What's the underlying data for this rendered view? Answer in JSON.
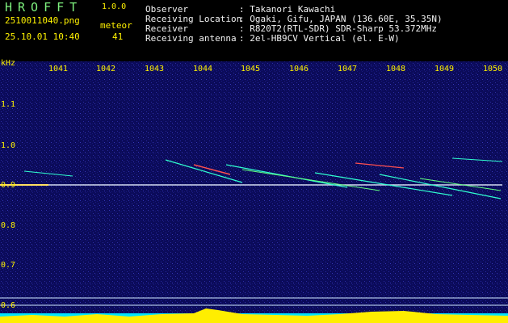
{
  "app": {
    "name": "HROFFT",
    "version": "1.0.0",
    "filename": "2510011040.png",
    "datetime": "25.10.01 10:40",
    "meteor_label": "meteor",
    "meteor_count": "41"
  },
  "info": [
    {
      "key": "Observer",
      "value": ": Takanori Kawachi"
    },
    {
      "key": "Receiving Location",
      "value": ": Ogaki, Gifu, JAPAN (136.60E, 35.35N)"
    },
    {
      "key": "Receiver",
      "value": ": R820T2(RTL-SDR) SDR-Sharp 53.372MHz"
    },
    {
      "key": "Receiving antenna",
      "value": ": 2el-HB9CV Vertical (el. E-W)"
    }
  ],
  "axes": {
    "y_unit": "kHz",
    "x_ticks": [
      "1041",
      "1042",
      "1043",
      "1044",
      "1045",
      "1046",
      "1047",
      "1048",
      "1049",
      "1050"
    ],
    "y_ticks": [
      "1.1",
      "1.0",
      "0.9",
      "0.8",
      "0.7",
      "0.6"
    ]
  },
  "colors": {
    "background": "#000000",
    "header_green": "#7ef07e",
    "axis_yellow": "#fff200",
    "spectrogram_bg": "#0a0a55",
    "signal_line": "#ffffff",
    "bottom_bar_cyan": "#00e5ff",
    "bottom_bar_yellow": "#ffee00"
  }
}
